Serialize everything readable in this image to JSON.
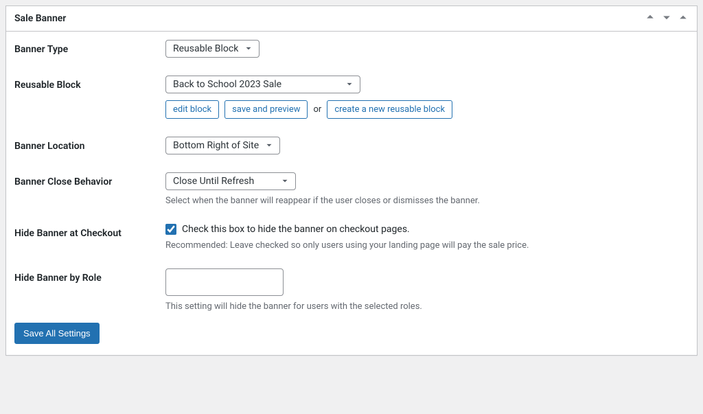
{
  "panel": {
    "title": "Sale Banner"
  },
  "fields": {
    "banner_type": {
      "label": "Banner Type",
      "value": "Reusable Block"
    },
    "reusable_block": {
      "label": "Reusable Block",
      "value": "Back to School 2023 Sale",
      "edit_block_label": "edit block",
      "save_preview_label": "save and preview",
      "or_text": "or",
      "create_new_label": "create a new reusable block"
    },
    "banner_location": {
      "label": "Banner Location",
      "value": "Bottom Right of Site"
    },
    "banner_close_behavior": {
      "label": "Banner Close Behavior",
      "value": "Close Until Refresh",
      "description": "Select when the banner will reappear if the user closes or dismisses the banner."
    },
    "hide_checkout": {
      "label": "Hide Banner at Checkout",
      "checkbox_label": "Check this box to hide the banner on checkout pages.",
      "description": "Recommended: Leave checked so only users using your landing page will pay the sale price."
    },
    "hide_role": {
      "label": "Hide Banner by Role",
      "description": "This setting will hide the banner for users with the selected roles."
    }
  },
  "actions": {
    "save_all": "Save All Settings"
  }
}
